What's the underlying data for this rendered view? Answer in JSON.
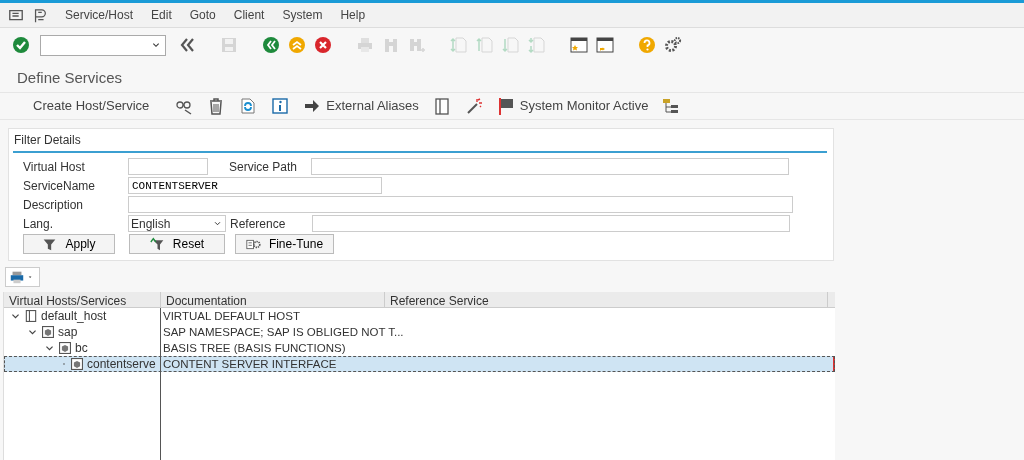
{
  "menu": {
    "items": [
      "Service/Host",
      "Edit",
      "Goto",
      "Client",
      "System",
      "Help"
    ]
  },
  "toolbar": [
    {
      "kind": "enter",
      "disabled": false
    },
    {
      "kind": "command"
    },
    {
      "kind": "collapse",
      "disabled": false
    },
    {
      "kind": "save",
      "disabled": true
    },
    {
      "kind": "back",
      "disabled": false
    },
    {
      "kind": "exit",
      "disabled": false
    },
    {
      "kind": "cancel",
      "disabled": false
    },
    {
      "kind": "print",
      "disabled": true
    },
    {
      "kind": "find",
      "disabled": true
    },
    {
      "kind": "findnext",
      "disabled": true
    },
    {
      "kind": "first",
      "disabled": true
    },
    {
      "kind": "prev",
      "disabled": true
    },
    {
      "kind": "next",
      "disabled": true
    },
    {
      "kind": "last",
      "disabled": true
    },
    {
      "kind": "session",
      "disabled": false
    },
    {
      "kind": "shortcut",
      "disabled": false
    },
    {
      "kind": "help",
      "disabled": false
    },
    {
      "kind": "settings",
      "disabled": false
    }
  ],
  "title": "Define Services",
  "app_toolbar": [
    {
      "kind": "text",
      "label": "Create Host/Service"
    },
    {
      "kind": "glasses"
    },
    {
      "kind": "trash"
    },
    {
      "kind": "refresh"
    },
    {
      "kind": "info"
    },
    {
      "kind": "arrow",
      "label": "External Aliases"
    },
    {
      "kind": "book"
    },
    {
      "kind": "wand"
    },
    {
      "kind": "flag",
      "label": "System Monitor Active"
    },
    {
      "kind": "hierarchy"
    }
  ],
  "filter": {
    "title": "Filter Details",
    "rows": [
      [
        {
          "label": "Virtual Host",
          "kind": "short"
        },
        {
          "label": "Service Path",
          "kind": "long"
        }
      ],
      [
        {
          "label": "ServiceName",
          "kind": "medium",
          "value": "CONTENTSERVER"
        }
      ],
      [
        {
          "label": "Description",
          "kind": "full"
        }
      ],
      [
        {
          "label": "Lang.",
          "kind": "select",
          "value": "English"
        },
        {
          "label": "Reference",
          "kind": "long"
        }
      ]
    ],
    "buttons": [
      {
        "kind": "filter",
        "label": "Apply"
      },
      {
        "kind": "reset",
        "label": "Reset"
      },
      {
        "kind": "tune",
        "label": "Fine-Tune"
      }
    ]
  },
  "tree": {
    "columns": [
      "Virtual Hosts/Services",
      "Documentation",
      "Reference Service"
    ],
    "nodes": [
      {
        "name": "default_host",
        "documentation": "VIRTUAL DEFAULT HOST",
        "expanded": true,
        "selected": false,
        "children": [
          {
            "name": "sap",
            "documentation": "SAP NAMESPACE; SAP IS OBLIGED NOT T...",
            "expanded": true,
            "selected": false,
            "children": [
              {
                "name": "bc",
                "documentation": "BASIS TREE (BASIS FUNCTIONS)",
                "expanded": true,
                "selected": false,
                "children": [
                  {
                    "name": "contentserve",
                    "documentation": "CONTENT SERVER INTERFACE",
                    "selected": true
                  }
                ]
              }
            ]
          }
        ]
      }
    ]
  }
}
